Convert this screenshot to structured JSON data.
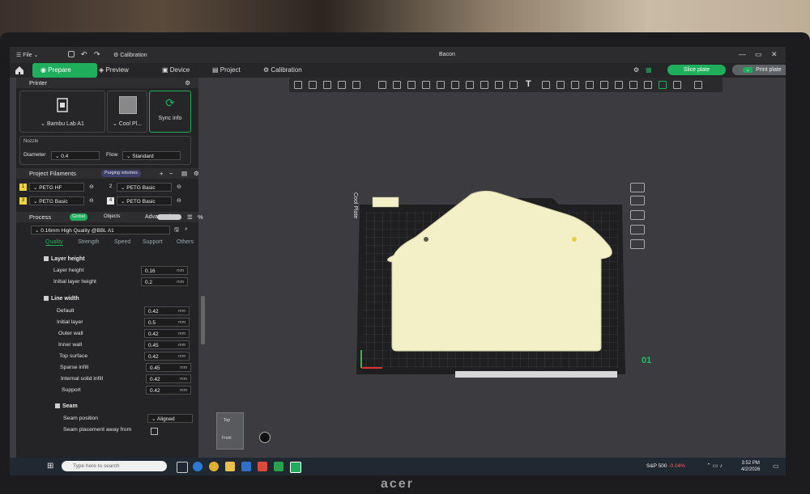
{
  "window": {
    "app_title": "Bacon",
    "file_menu": "File",
    "calibration_short": "Calibration"
  },
  "nav": {
    "tabs": [
      {
        "label": "Prepare",
        "active": true
      },
      {
        "label": "Preview"
      },
      {
        "label": "Device"
      },
      {
        "label": "Project"
      },
      {
        "label": "Calibration"
      }
    ],
    "slice_button": "Slice plate",
    "print_button": "Print plate"
  },
  "printer": {
    "section_title": "Printer",
    "printer_name": "Bambu Lab A1",
    "plate_type": "Cool Pl...",
    "sync_label": "Sync info",
    "nozzle_title": "Nozzle",
    "diameter_label": "Diameter",
    "diameter_value": "0.4",
    "flow_label": "Flow",
    "flow_value": "Standard"
  },
  "filaments": {
    "section_title": "Project Filaments",
    "purge_button": "Purging volumes",
    "items": [
      {
        "slot": "1",
        "name": "PETG HF",
        "color": "#f1d33a"
      },
      {
        "slot": "2",
        "name": "PETG Basic",
        "color": "#e8e8e8"
      },
      {
        "slot": "3",
        "name": "PETG Basic",
        "color": "#f1d33a"
      },
      {
        "slot": "4",
        "name": "PETG Basic",
        "color": "#e8e8e8"
      }
    ]
  },
  "process": {
    "section_title": "Process",
    "toggle_global": "Global",
    "toggle_objects": "Objects",
    "advanced_label": "Advanced",
    "preset": "0.16mm High Quality @BBL A1",
    "tabs": [
      "Quality",
      "Strength",
      "Speed",
      "Support",
      "Others"
    ],
    "layer_height": {
      "title": "Layer height",
      "rows": [
        {
          "label": "Layer height",
          "value": "0.16",
          "unit": "mm"
        },
        {
          "label": "Initial layer height",
          "value": "0.2",
          "unit": "mm"
        }
      ]
    },
    "line_width": {
      "title": "Line width",
      "rows": [
        {
          "label": "Default",
          "value": "0.42",
          "unit": "mm"
        },
        {
          "label": "Initial layer",
          "value": "0.5",
          "unit": "mm"
        },
        {
          "label": "Outer wall",
          "value": "0.42",
          "unit": "mm"
        },
        {
          "label": "Inner wall",
          "value": "0.45",
          "unit": "mm"
        },
        {
          "label": "Top surface",
          "value": "0.42",
          "unit": "mm"
        },
        {
          "label": "Sparse infill",
          "value": "0.45",
          "unit": "mm"
        },
        {
          "label": "Internal solid infill",
          "value": "0.42",
          "unit": "mm"
        },
        {
          "label": "Support",
          "value": "0.42",
          "unit": "mm"
        }
      ]
    },
    "seam": {
      "title": "Seam",
      "position_label": "Seam position",
      "position_value": "Aligned",
      "away_label": "Seam placement away from"
    }
  },
  "viewport": {
    "plate_label": "Cool Plate",
    "plate_number": "01",
    "view_top": "Top",
    "view_front": "Front",
    "object_color": "#f3f0c8"
  },
  "taskbar": {
    "search_placeholder": "Type here to search",
    "stock_name": "S&P 500",
    "stock_change": "-0.04%",
    "time": "3:52 PM",
    "date": "4/2/2026"
  },
  "brand": "acer",
  "accent_color": "#1fae5b"
}
